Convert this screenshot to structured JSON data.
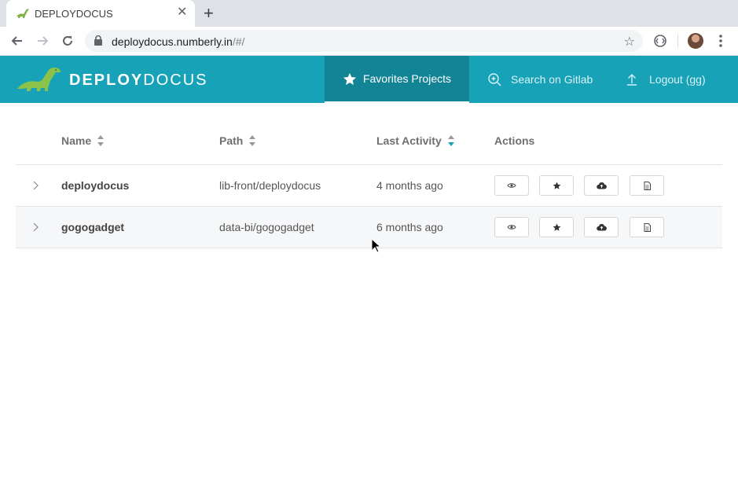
{
  "browser": {
    "tab_title": "DEPLOYDOCUS",
    "url_host": "deploydocus.numberly.in",
    "url_path": "/#/"
  },
  "header": {
    "brand_bold": "DEPLOY",
    "brand_light": "DOCUS",
    "nav": [
      {
        "label": "Favorites Projects",
        "icon": "star-icon",
        "active": true
      },
      {
        "label": "Search on Gitlab",
        "icon": "search-icon",
        "active": false
      },
      {
        "label": "Logout (gg)",
        "icon": "upload-icon",
        "active": false
      }
    ],
    "accent_color": "#17a2b8"
  },
  "table": {
    "columns": [
      "Name",
      "Path",
      "Last Activity",
      "Actions"
    ],
    "sorted_column": "Last Activity",
    "rows": [
      {
        "name": "deploydocus",
        "path": "lib-front/deploydocus",
        "activity": "4 months ago"
      },
      {
        "name": "gogogadget",
        "path": "data-bi/gogogadget",
        "activity": "6 months ago"
      }
    ],
    "action_icons": [
      "eye-icon",
      "star-icon",
      "cloud-upload-icon",
      "document-icon"
    ]
  }
}
